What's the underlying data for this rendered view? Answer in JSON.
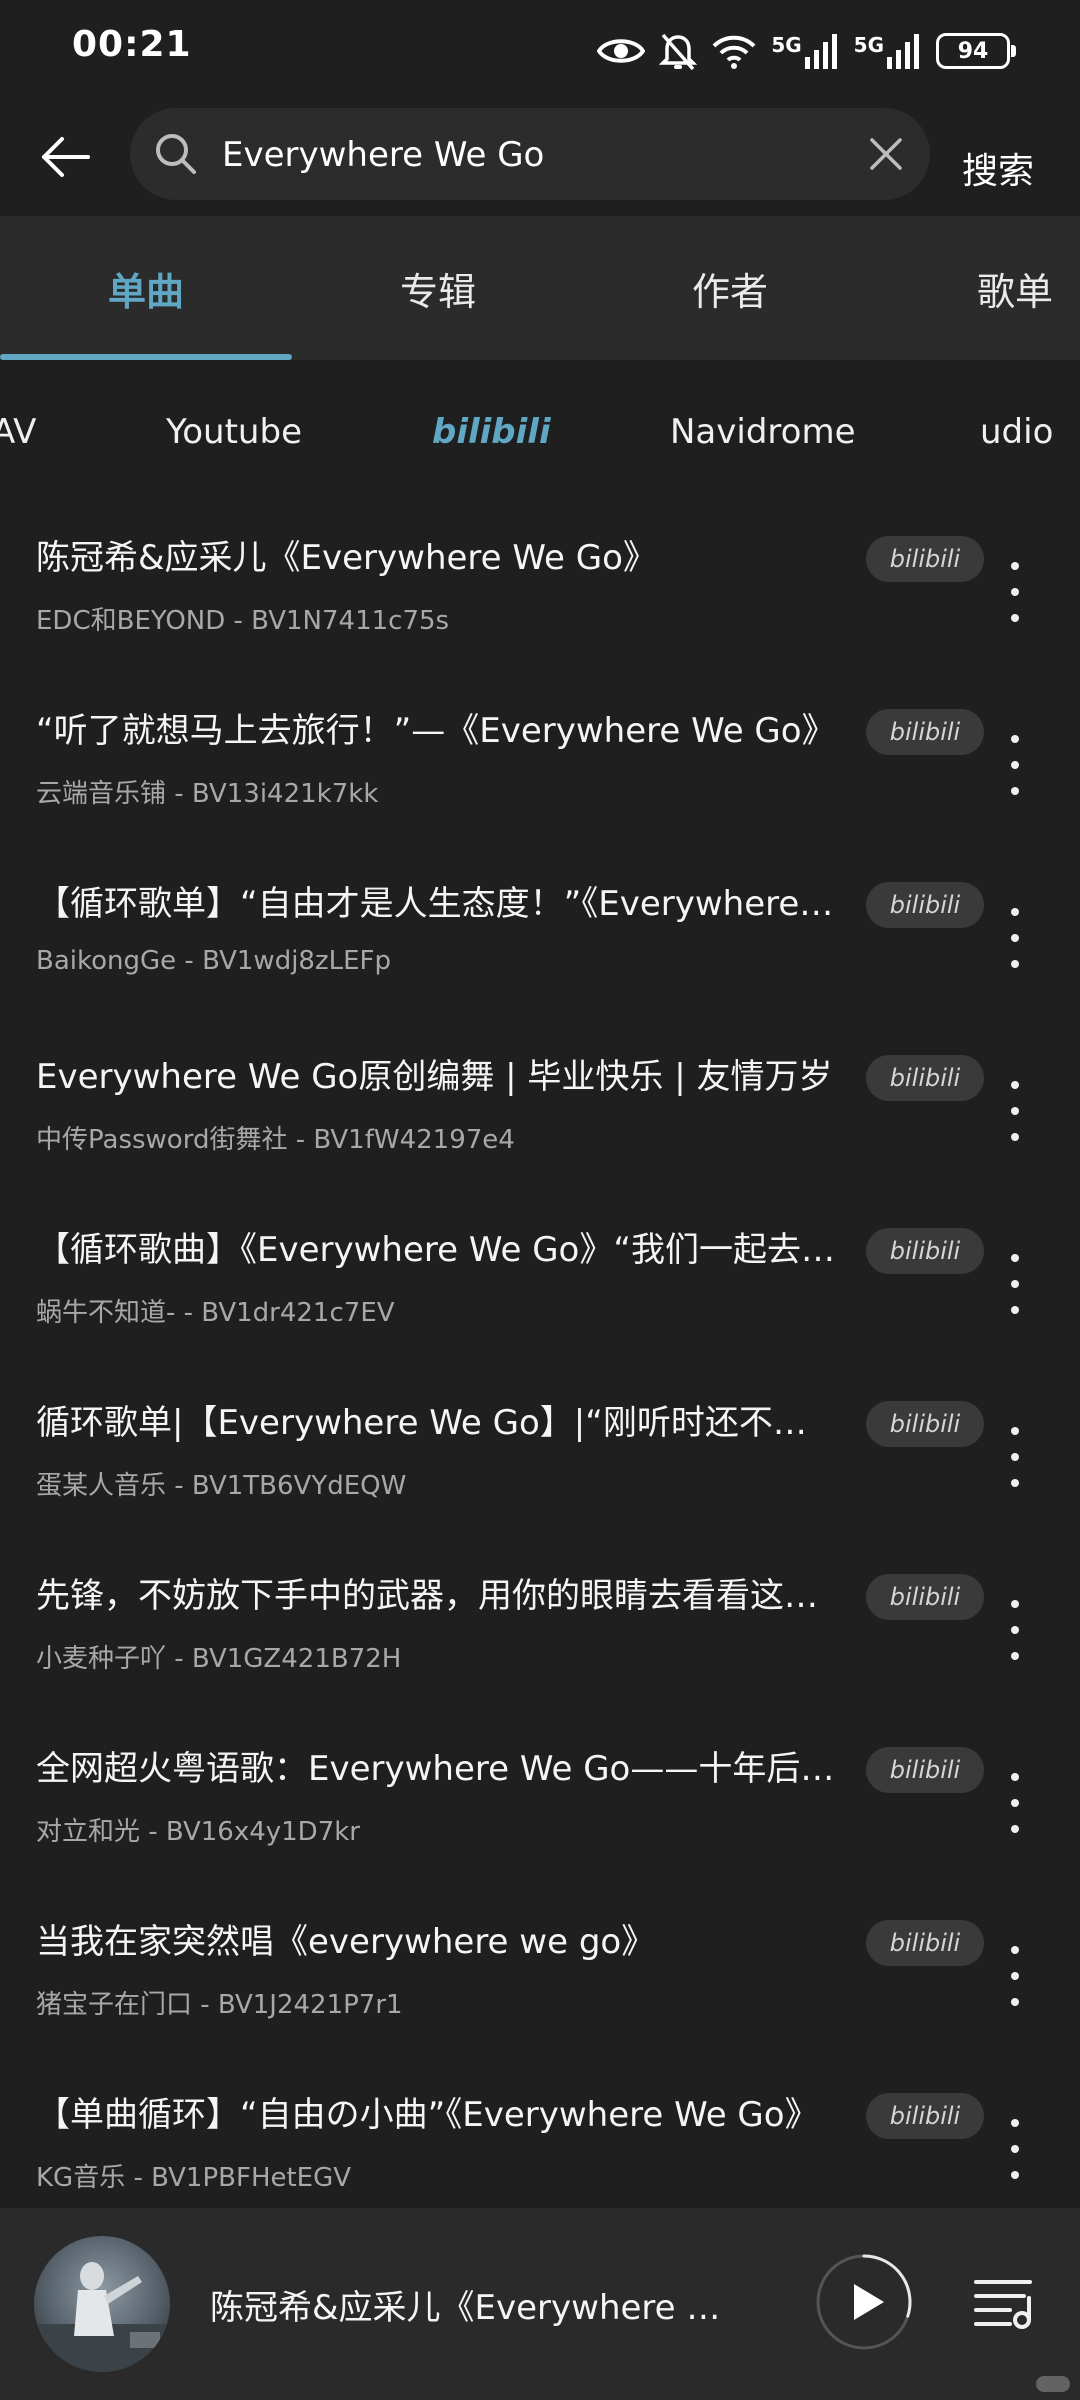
{
  "status_bar": {
    "time": "00:21",
    "battery": "94",
    "network_1": "5G",
    "network_2": "5G"
  },
  "search": {
    "query": "Everywhere We Go",
    "submit_label": "搜索"
  },
  "category_tabs": [
    {
      "label": "单曲",
      "active": true
    },
    {
      "label": "专辑",
      "active": false
    },
    {
      "label": "作者",
      "active": false
    },
    {
      "label": "歌单",
      "active": false
    }
  ],
  "source_tabs": [
    {
      "label": "AV",
      "active": false
    },
    {
      "label": "Youtube",
      "active": false
    },
    {
      "label": "bilibili",
      "active": true
    },
    {
      "label": "Navidrome",
      "active": false
    },
    {
      "label": "udio",
      "active": false
    }
  ],
  "results": [
    {
      "title": "陈冠希&应采儿《Everywhere We Go》",
      "subtitle": "EDC和BEYOND - BV1N7411c75s",
      "source": "bilibili"
    },
    {
      "title": "“听了就想马上去旅行！”—《Everywhere We Go》",
      "subtitle": "云端音乐铺 - BV13i421k7kk",
      "source": "bilibili"
    },
    {
      "title": "【循环歌单】“自由才是人生态度！”《Everywhere We Go》",
      "subtitle": "BaikongGe - BV1wdj8zLEFp",
      "source": "bilibili"
    },
    {
      "title": "Everywhere We Go原创编舞 | 毕业快乐 | 友情万岁",
      "subtitle": "中传Password街舞社 - BV1fW42197e4",
      "source": "bilibili"
    },
    {
      "title": "【循环歌曲】《Everywhere We Go》“我们一起去流浪”",
      "subtitle": "蜗牛不知道- - BV1dr421c7EV",
      "source": "bilibili"
    },
    {
      "title": "循环歌单|【Everywhere We Go】|“刚听时还不觉得”",
      "subtitle": "蛋某人音乐 - BV1TB6VYdEQW",
      "source": "bilibili"
    },
    {
      "title": "先锋，不妨放下手中的武器，用你的眼睛去看看这个世界",
      "subtitle": "小麦种子吖 - BV1GZ421B72H",
      "source": "bilibili"
    },
    {
      "title": "全网超火粤语歌：Everywhere We Go——十年后再听",
      "subtitle": "对立和光 - BV16x4y1D7kr",
      "source": "bilibili"
    },
    {
      "title": "当我在家突然唱《everywhere we go》",
      "subtitle": "猪宝子在门口 - BV1J2421P7r1",
      "source": "bilibili"
    },
    {
      "title": "【单曲循环】“自由の小曲”《Everywhere We Go》",
      "subtitle": "KG音乐 - BV1PBFHetEGV",
      "source": "bilibili"
    }
  ],
  "player": {
    "title": "陈冠希&应采儿《Everywhere We Go》",
    "progress": 0.3
  }
}
